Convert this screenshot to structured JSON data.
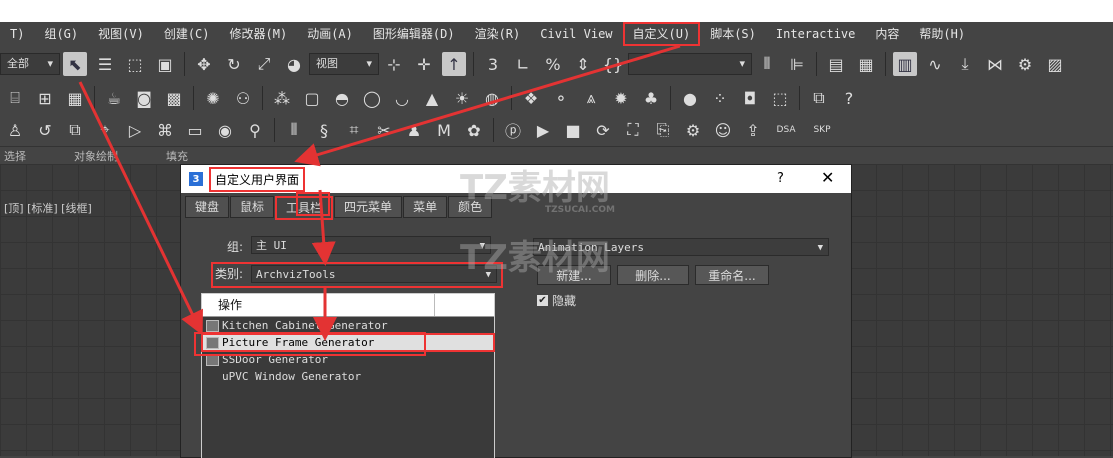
{
  "menubar": {
    "items": [
      "T)",
      "组(G)",
      "视图(V)",
      "创建(C)",
      "修改器(M)",
      "动画(A)",
      "图形编辑器(D)",
      "渲染(R)",
      "Civil View",
      "自定义(U)",
      "脚本(S)",
      "Interactive",
      "内容",
      "帮助(H)"
    ],
    "highlighted_index": 9
  },
  "toolbar": {
    "selection_filter": "全部",
    "view_dropdown": "视图",
    "named_selection": ""
  },
  "ribbon": {
    "labels": [
      "选择",
      "对象绘制",
      "填充"
    ]
  },
  "viewport": {
    "label": "[顶] [标准] [线框]"
  },
  "dialog": {
    "icon": "3",
    "title": "自定义用户界面",
    "help": "?",
    "close": "✕",
    "tabs": [
      "键盘",
      "鼠标",
      "工具栏",
      "四元菜单",
      "菜单",
      "颜色"
    ],
    "active_tab": 2,
    "group_label": "组:",
    "group_value": "主 UI",
    "category_label": "类别:",
    "category_value": "ArchvizTools",
    "list_header": "操作",
    "actions": [
      "Kitchen Cabinet Generator",
      "Picture Frame Generator",
      "SSDoor Generator",
      "uPVC Window Generator"
    ],
    "selected_action": 1,
    "toolbar_value": "Animation Layers",
    "new_button": "新建...",
    "delete_button": "删除...",
    "rename_button": "重命名...",
    "hide_label": "隐藏",
    "hide_checked": true
  },
  "watermark": {
    "text": "TZ素材网",
    "sub": "TZSUCAI.COM"
  },
  "colors": {
    "annotation": "#e33333",
    "background": "#444444"
  }
}
